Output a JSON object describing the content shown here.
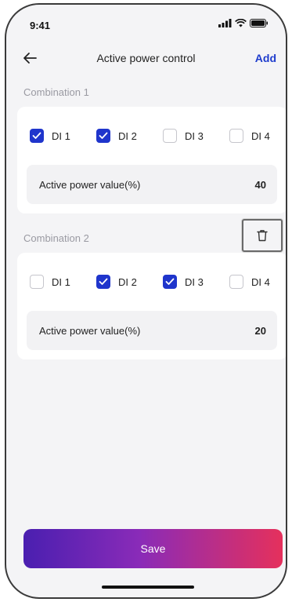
{
  "status": {
    "time": "9:41"
  },
  "header": {
    "title": "Active power control",
    "add_label": "Add"
  },
  "combinations": [
    {
      "title": "Combination 1",
      "inputs": [
        {
          "label": "DI 1",
          "checked": true
        },
        {
          "label": "DI 2",
          "checked": true
        },
        {
          "label": "DI 3",
          "checked": false
        },
        {
          "label": "DI 4",
          "checked": false
        }
      ],
      "value_label": "Active power value(%)",
      "value": "40"
    },
    {
      "title": "Combination 2",
      "inputs": [
        {
          "label": "DI 1",
          "checked": false
        },
        {
          "label": "DI 2",
          "checked": true
        },
        {
          "label": "DI 3",
          "checked": true
        },
        {
          "label": "DI 4",
          "checked": false
        }
      ],
      "value_label": "Active power value(%)",
      "value": "20"
    }
  ],
  "footer": {
    "save_label": "Save"
  },
  "colors": {
    "accent": "#1e3ccd",
    "checkbox_checked": "#1f35cc",
    "gradient_start": "#4a1fb0",
    "gradient_end": "#e5305c"
  },
  "icons": [
    "back-arrow-icon",
    "trash-icon",
    "signal-icon",
    "wifi-icon",
    "battery-icon",
    "checkmark-icon"
  ]
}
